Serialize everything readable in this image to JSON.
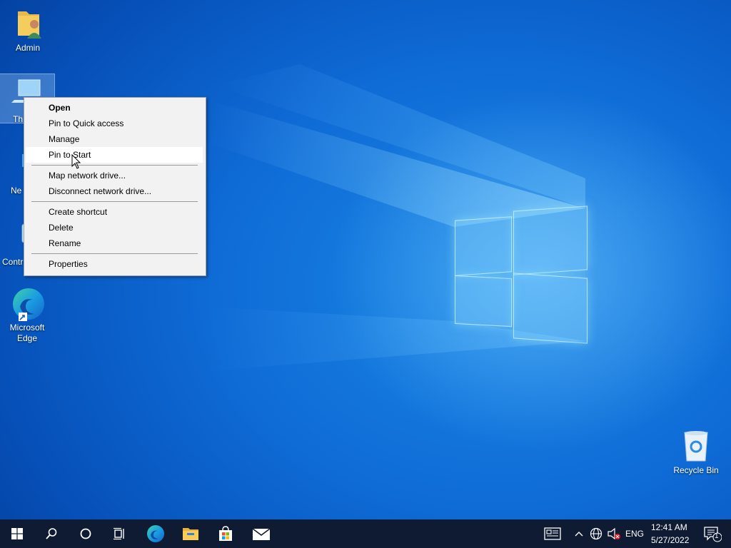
{
  "desktop": {
    "icons": [
      {
        "label": "Admin"
      },
      {
        "label": "Th"
      },
      {
        "label": "Ne"
      },
      {
        "label": "Contr"
      },
      {
        "label": "Microsoft Edge"
      },
      {
        "label": "Recycle Bin"
      }
    ]
  },
  "context_menu": {
    "items": [
      {
        "label": "Open"
      },
      {
        "label": "Pin to Quick access"
      },
      {
        "label": "Manage"
      },
      {
        "label": "Pin to Start"
      },
      {
        "label": "Map network drive..."
      },
      {
        "label": "Disconnect network drive..."
      },
      {
        "label": "Create shortcut"
      },
      {
        "label": "Delete"
      },
      {
        "label": "Rename"
      },
      {
        "label": "Properties"
      }
    ]
  },
  "taskbar": {
    "pinned": [
      "start-icon",
      "search-icon",
      "cortana-icon",
      "task-view-icon",
      "edge-icon",
      "file-explorer-icon",
      "store-icon",
      "mail-icon"
    ],
    "tray": {
      "language": "ENG",
      "time": "12:41 AM",
      "date": "5/27/2022",
      "notification_count": "1"
    }
  },
  "colors": {
    "taskbar": "#0f1a33",
    "wallpaper": "#0f6bd6",
    "menu_bg": "#f2f2f2"
  }
}
